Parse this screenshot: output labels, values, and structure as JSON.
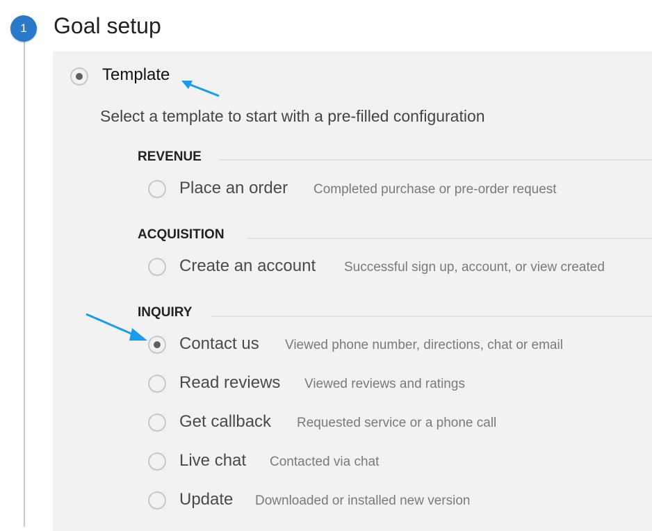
{
  "step": {
    "number": "1",
    "title": "Goal setup"
  },
  "template_option": {
    "label": "Template",
    "selected": true
  },
  "subtitle": "Select a template to start with a pre-filled configuration",
  "categories": [
    {
      "name": "REVENUE",
      "options": [
        {
          "label": "Place an order",
          "description": "Completed purchase or pre-order request",
          "selected": false
        }
      ]
    },
    {
      "name": "ACQUISITION",
      "options": [
        {
          "label": "Create an account",
          "description": "Successful sign up, account, or view created",
          "selected": false
        }
      ]
    },
    {
      "name": "INQUIRY",
      "options": [
        {
          "label": "Contact us",
          "description": "Viewed phone number, directions, chat or email",
          "selected": true
        },
        {
          "label": "Read reviews",
          "description": "Viewed reviews and ratings",
          "selected": false
        },
        {
          "label": "Get callback",
          "description": "Requested service or a phone call",
          "selected": false
        },
        {
          "label": "Live chat",
          "description": "Contacted via chat",
          "selected": false
        },
        {
          "label": "Update",
          "description": "Downloaded or installed new version",
          "selected": false
        }
      ]
    }
  ],
  "colors": {
    "accent": "#2a7ac9",
    "annotation_arrow": "#1a9bf0",
    "panel": "#f2f2f2"
  }
}
